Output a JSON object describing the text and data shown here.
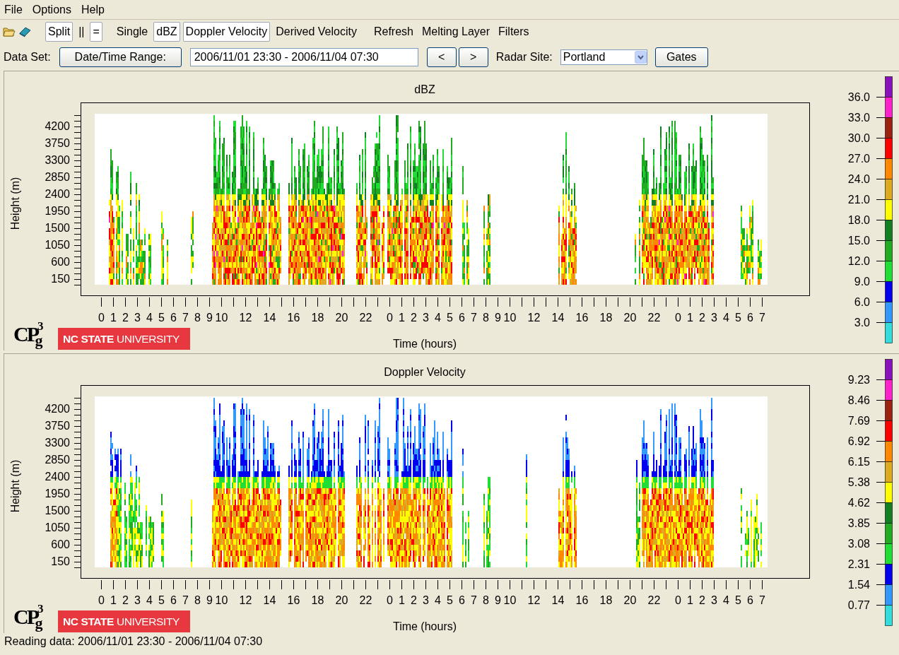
{
  "menu": [
    {
      "label": "File"
    },
    {
      "label": "Options"
    },
    {
      "label": "Help"
    }
  ],
  "toolbar": {
    "items": [
      {
        "label": "Split",
        "selected": true
      },
      {
        "label": "||",
        "selected": false
      },
      {
        "label": "=",
        "selected": true
      },
      {
        "label": "Single",
        "selected": false
      },
      {
        "label": "dBZ",
        "selected": true
      },
      {
        "label": "Doppler Velocity",
        "selected": true
      },
      {
        "label": "Derived Velocity",
        "selected": false
      },
      {
        "label": "Refresh",
        "selected": false
      },
      {
        "label": "Melting Layer",
        "selected": false
      },
      {
        "label": "Filters",
        "selected": false
      }
    ]
  },
  "data_set": {
    "label": "Data Set:",
    "range_button": "Date/Time Range:",
    "range_value": "2006/11/01 23:30 - 2006/11/04 07:30",
    "prev_button": "<",
    "next_button": ">",
    "site_label": "Radar Site:",
    "site_value": "Portland",
    "gates_button": "Gates"
  },
  "panels": [
    {
      "title": "dBZ",
      "kind": "dbz",
      "y_label": "Height (m)",
      "y_ticks": [
        "4200",
        "3750",
        "3300",
        "2850",
        "2400",
        "1950",
        "1500",
        "1050",
        "600",
        "150"
      ],
      "x_label": "Time (hours)",
      "x_ticks": [
        {
          "kind": "major",
          "label": "0"
        },
        {
          "kind": "major",
          "label": "1"
        },
        {
          "kind": "major",
          "label": "2"
        },
        {
          "kind": "major",
          "label": "3"
        },
        {
          "kind": "major",
          "label": "4"
        },
        {
          "kind": "major",
          "label": "5"
        },
        {
          "kind": "major",
          "label": "6"
        },
        {
          "kind": "major",
          "label": "7"
        },
        {
          "kind": "major",
          "label": "8"
        },
        {
          "kind": "major",
          "label": "9"
        },
        {
          "kind": "major",
          "label": "10"
        },
        {
          "kind": "minor"
        },
        {
          "kind": "major",
          "label": "12"
        },
        {
          "kind": "minor"
        },
        {
          "kind": "major",
          "label": "14"
        },
        {
          "kind": "minor"
        },
        {
          "kind": "major",
          "label": "16"
        },
        {
          "kind": "minor"
        },
        {
          "kind": "major",
          "label": "18"
        },
        {
          "kind": "minor"
        },
        {
          "kind": "major",
          "label": "20"
        },
        {
          "kind": "minor"
        },
        {
          "kind": "major",
          "label": "22"
        },
        {
          "kind": "minor"
        },
        {
          "kind": "major",
          "label": "0"
        },
        {
          "kind": "major",
          "label": "1"
        },
        {
          "kind": "major",
          "label": "2"
        },
        {
          "kind": "major",
          "label": "3"
        },
        {
          "kind": "major",
          "label": "4"
        },
        {
          "kind": "major",
          "label": "5"
        },
        {
          "kind": "major",
          "label": "6"
        },
        {
          "kind": "major",
          "label": "7"
        },
        {
          "kind": "major",
          "label": "8"
        },
        {
          "kind": "major",
          "label": "9"
        },
        {
          "kind": "major",
          "label": "10"
        },
        {
          "kind": "minor"
        },
        {
          "kind": "major",
          "label": "12"
        },
        {
          "kind": "minor"
        },
        {
          "kind": "major",
          "label": "14"
        },
        {
          "kind": "minor"
        },
        {
          "kind": "major",
          "label": "16"
        },
        {
          "kind": "minor"
        },
        {
          "kind": "major",
          "label": "18"
        },
        {
          "kind": "minor"
        },
        {
          "kind": "major",
          "label": "20"
        },
        {
          "kind": "minor"
        },
        {
          "kind": "major",
          "label": "22"
        },
        {
          "kind": "minor"
        },
        {
          "kind": "major",
          "label": "0"
        },
        {
          "kind": "major",
          "label": "1"
        },
        {
          "kind": "major",
          "label": "2"
        },
        {
          "kind": "major",
          "label": "3"
        },
        {
          "kind": "major",
          "label": "4"
        },
        {
          "kind": "major",
          "label": "5"
        },
        {
          "kind": "major",
          "label": "6"
        },
        {
          "kind": "major",
          "label": "7"
        }
      ],
      "colorbar": {
        "labels": [
          "36.0",
          "33.0",
          "30.0",
          "27.0",
          "24.0",
          "21.0",
          "18.0",
          "15.0",
          "12.0",
          "9.0",
          "6.0",
          "3.0"
        ],
        "segments": [
          {
            "color": "#8811bb"
          },
          {
            "color": "#ff22cc"
          },
          {
            "color": "#992211"
          },
          {
            "color": "#ff0000"
          },
          {
            "color": "#ff8800"
          },
          {
            "color": "#ddaa22"
          },
          {
            "color": "#ffff00"
          },
          {
            "color": "#117f22"
          },
          {
            "color": "#22aa22"
          },
          {
            "color": "#22dd33"
          },
          {
            "color": "#0000ee"
          },
          {
            "color": "#3399ff"
          },
          {
            "color": "#33dddd"
          }
        ]
      },
      "logo": {
        "main": "CP",
        "sup": "3",
        "sub": "g"
      },
      "banner": {
        "bold": "NC STATE",
        "light": "UNIVERSITY"
      }
    },
    {
      "title": "Doppler Velocity",
      "kind": "velocity",
      "y_label": "Height (m)",
      "y_ticks": [
        "4200",
        "3750",
        "3300",
        "2850",
        "2400",
        "1950",
        "1500",
        "1050",
        "600",
        "150"
      ],
      "x_label": "Time (hours)",
      "x_ticks": [
        {
          "kind": "major",
          "label": "0"
        },
        {
          "kind": "major",
          "label": "1"
        },
        {
          "kind": "major",
          "label": "2"
        },
        {
          "kind": "major",
          "label": "3"
        },
        {
          "kind": "major",
          "label": "4"
        },
        {
          "kind": "major",
          "label": "5"
        },
        {
          "kind": "major",
          "label": "6"
        },
        {
          "kind": "major",
          "label": "7"
        },
        {
          "kind": "major",
          "label": "8"
        },
        {
          "kind": "major",
          "label": "9"
        },
        {
          "kind": "major",
          "label": "10"
        },
        {
          "kind": "minor"
        },
        {
          "kind": "major",
          "label": "12"
        },
        {
          "kind": "minor"
        },
        {
          "kind": "major",
          "label": "14"
        },
        {
          "kind": "minor"
        },
        {
          "kind": "major",
          "label": "16"
        },
        {
          "kind": "minor"
        },
        {
          "kind": "major",
          "label": "18"
        },
        {
          "kind": "minor"
        },
        {
          "kind": "major",
          "label": "20"
        },
        {
          "kind": "minor"
        },
        {
          "kind": "major",
          "label": "22"
        },
        {
          "kind": "minor"
        },
        {
          "kind": "major",
          "label": "0"
        },
        {
          "kind": "major",
          "label": "1"
        },
        {
          "kind": "major",
          "label": "2"
        },
        {
          "kind": "major",
          "label": "3"
        },
        {
          "kind": "major",
          "label": "4"
        },
        {
          "kind": "major",
          "label": "5"
        },
        {
          "kind": "major",
          "label": "6"
        },
        {
          "kind": "major",
          "label": "7"
        },
        {
          "kind": "major",
          "label": "8"
        },
        {
          "kind": "major",
          "label": "9"
        },
        {
          "kind": "major",
          "label": "10"
        },
        {
          "kind": "minor"
        },
        {
          "kind": "major",
          "label": "12"
        },
        {
          "kind": "minor"
        },
        {
          "kind": "major",
          "label": "14"
        },
        {
          "kind": "minor"
        },
        {
          "kind": "major",
          "label": "16"
        },
        {
          "kind": "minor"
        },
        {
          "kind": "major",
          "label": "18"
        },
        {
          "kind": "minor"
        },
        {
          "kind": "major",
          "label": "20"
        },
        {
          "kind": "minor"
        },
        {
          "kind": "major",
          "label": "22"
        },
        {
          "kind": "minor"
        },
        {
          "kind": "major",
          "label": "0"
        },
        {
          "kind": "major",
          "label": "1"
        },
        {
          "kind": "major",
          "label": "2"
        },
        {
          "kind": "major",
          "label": "3"
        },
        {
          "kind": "major",
          "label": "4"
        },
        {
          "kind": "major",
          "label": "5"
        },
        {
          "kind": "major",
          "label": "6"
        },
        {
          "kind": "major",
          "label": "7"
        }
      ],
      "colorbar": {
        "labels": [
          "9.23",
          "8.46",
          "7.69",
          "6.92",
          "6.15",
          "5.38",
          "4.62",
          "3.85",
          "3.08",
          "2.31",
          "1.54",
          "0.77"
        ],
        "segments": [
          {
            "color": "#8811bb"
          },
          {
            "color": "#ff22cc"
          },
          {
            "color": "#992211"
          },
          {
            "color": "#ff0000"
          },
          {
            "color": "#ff8800"
          },
          {
            "color": "#ddaa22"
          },
          {
            "color": "#ffff00"
          },
          {
            "color": "#117f22"
          },
          {
            "color": "#22aa22"
          },
          {
            "color": "#22dd33"
          },
          {
            "color": "#0000ee"
          },
          {
            "color": "#3399ff"
          },
          {
            "color": "#33dddd"
          }
        ]
      },
      "logo": {
        "main": "CP",
        "sup": "3",
        "sub": "g"
      },
      "banner": {
        "bold": "NC STATE",
        "light": "UNIVERSITY"
      }
    }
  ],
  "status_bar": "Reading data: 2006/11/01 23:30 - 2006/11/04 07:30"
}
